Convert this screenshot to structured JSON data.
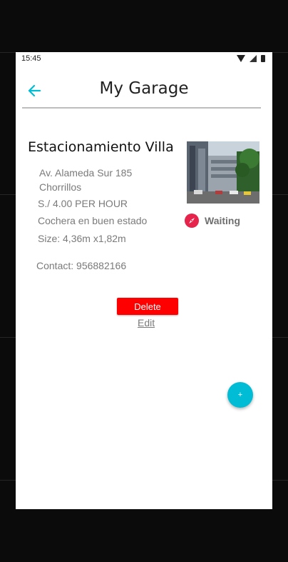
{
  "status_bar": {
    "time": "15:45"
  },
  "header": {
    "title": "My Garage"
  },
  "garage": {
    "name": "Estacionamiento Villa",
    "address_line1": "Av. Alameda Sur 185",
    "address_line2": "Chorrillos",
    "price": "S./ 4.00 PER HOUR",
    "description": "Cochera en buen estado",
    "size": "Size: 4,36m x1,82m",
    "contact": "Contact: 956882166",
    "status": "Waiting"
  },
  "actions": {
    "delete_label": "Delete",
    "edit_label": "Edit",
    "fab_label": "+"
  },
  "colors": {
    "accent": "#00bcd4",
    "delete": "#ff0000",
    "status_icon": "#e5234b"
  },
  "icons": {
    "back": "arrow-left-icon",
    "status": "compass-icon",
    "add": "plus-icon"
  }
}
